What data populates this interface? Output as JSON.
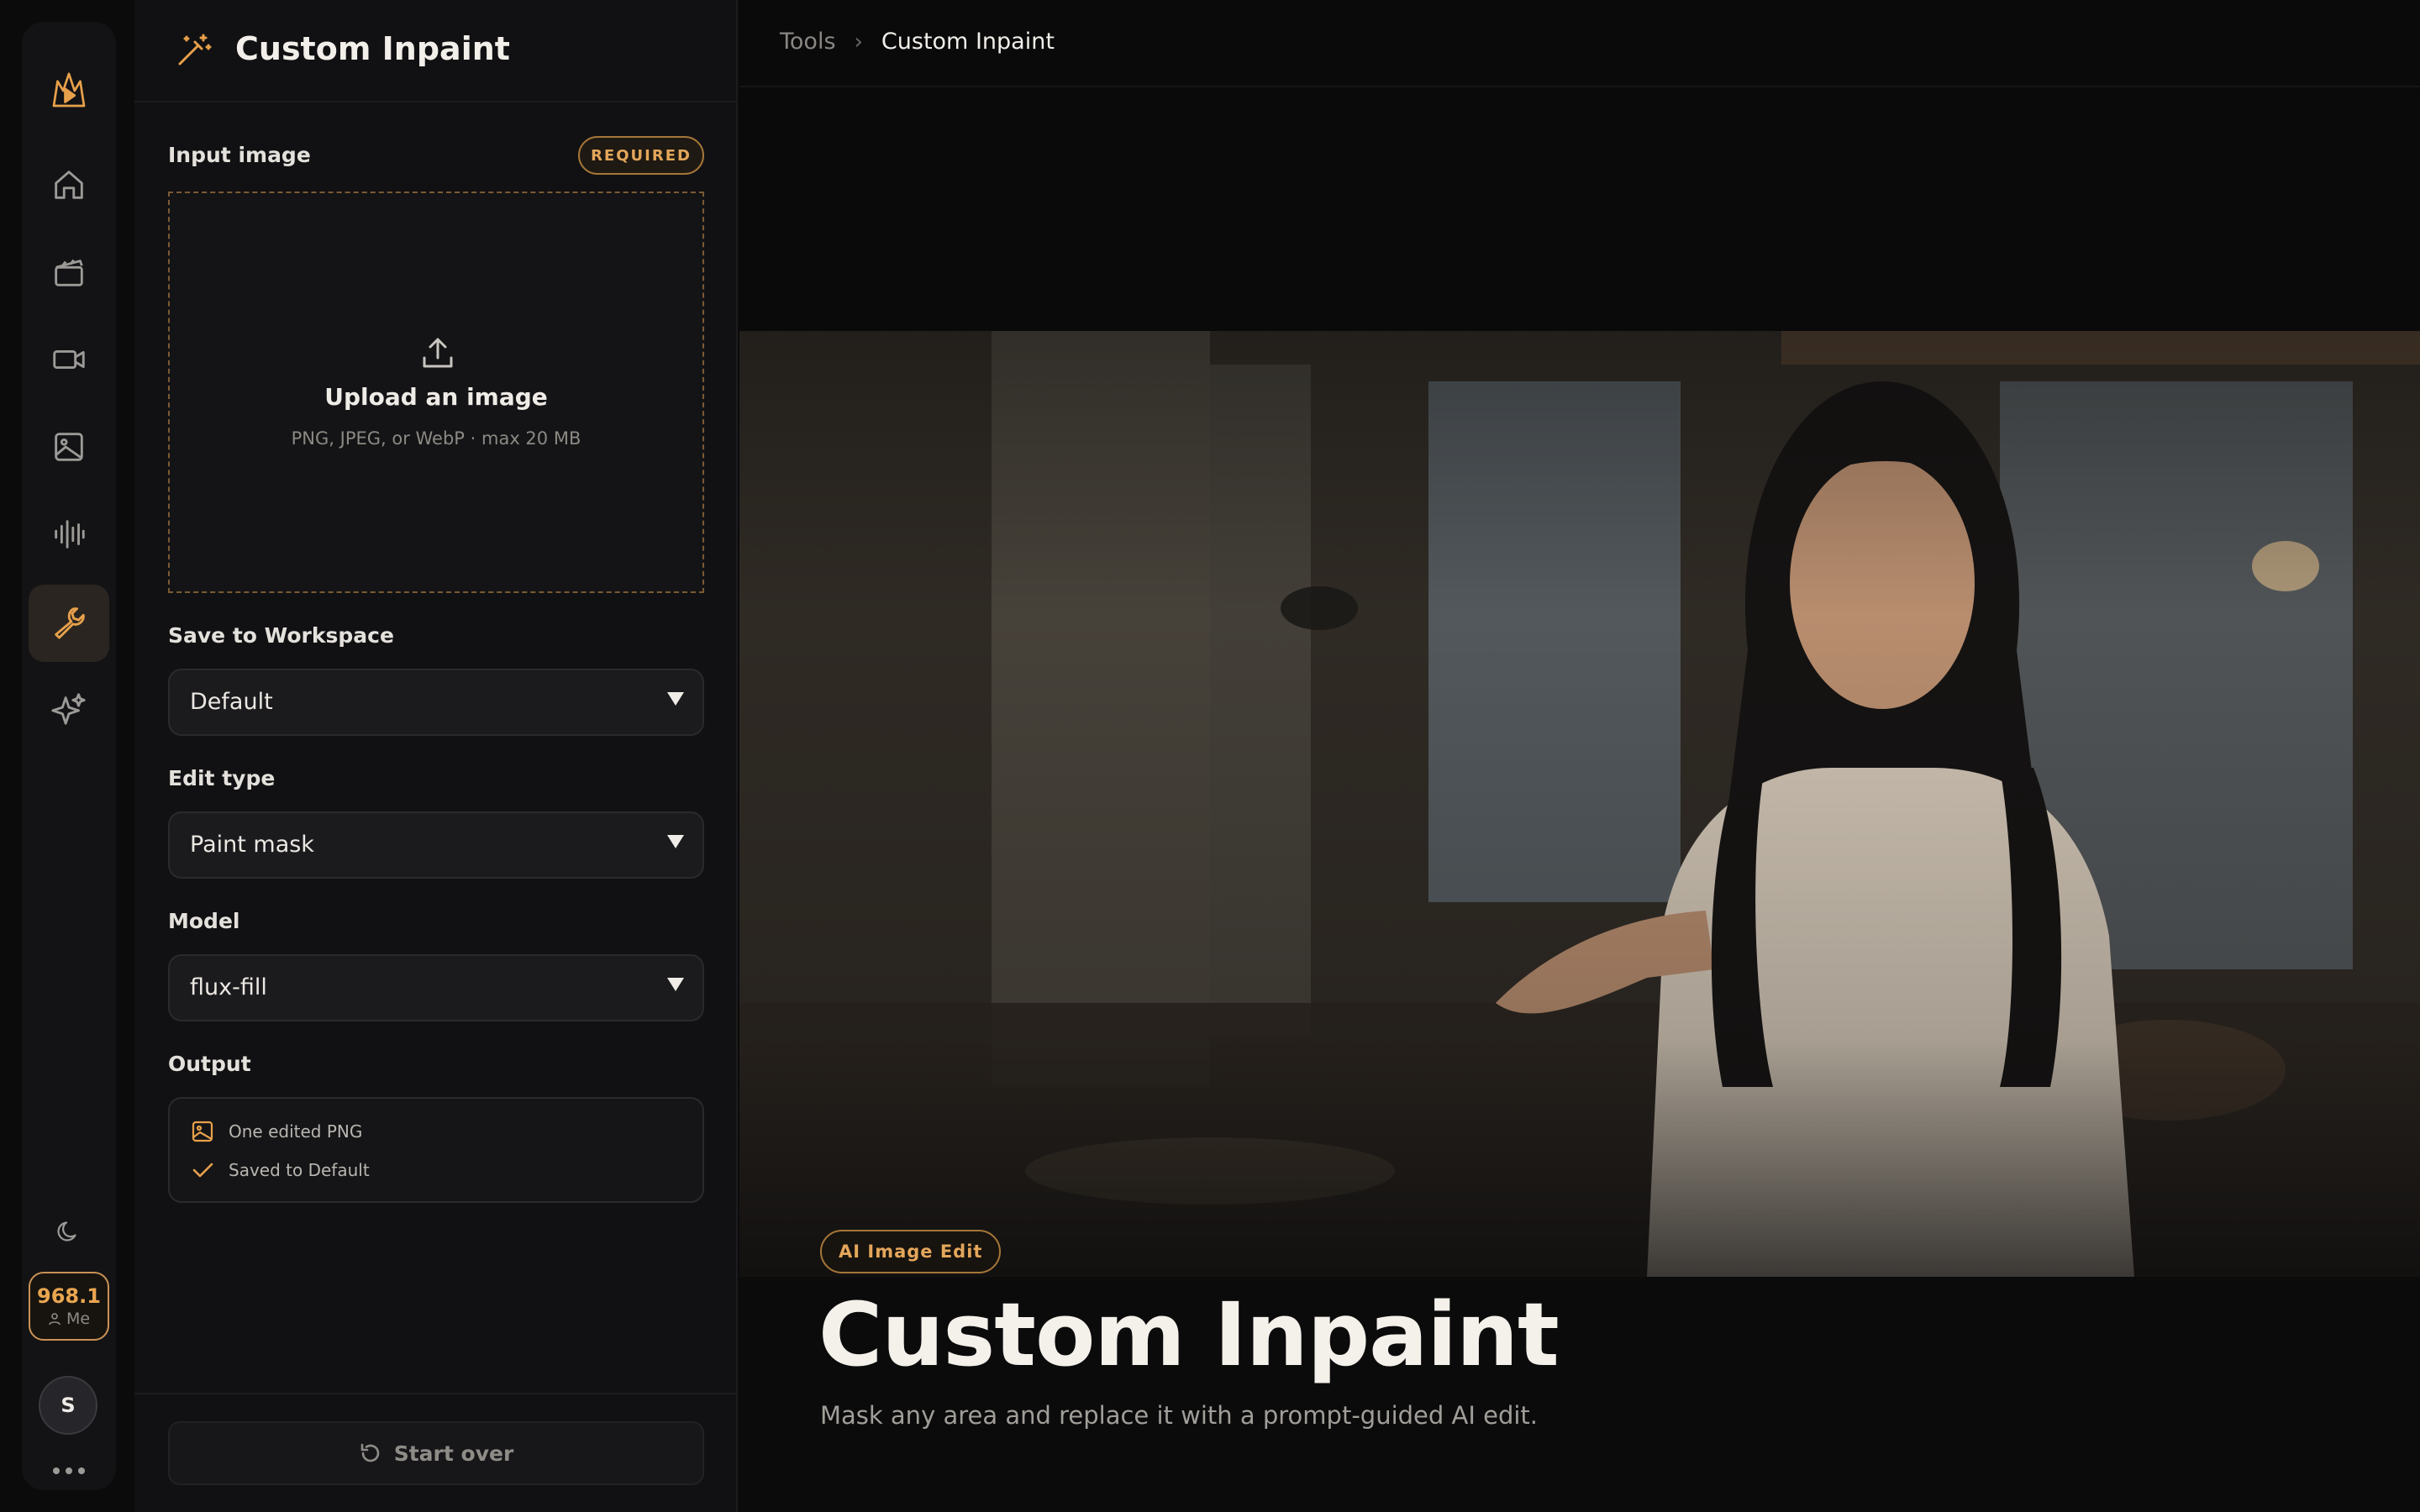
{
  "sidebar": {
    "items": [
      {
        "icon": "logo-icon"
      },
      {
        "icon": "home-icon"
      },
      {
        "icon": "clapperboard-icon"
      },
      {
        "icon": "video-camera-icon"
      },
      {
        "icon": "image-icon"
      },
      {
        "icon": "audio-waveform-icon"
      },
      {
        "icon": "wrench-icon",
        "active": true
      },
      {
        "icon": "sparkles-icon"
      }
    ],
    "theme_icon": "moon-icon",
    "credits": {
      "value": "968.1",
      "user": "Me"
    },
    "avatar_initial": "S"
  },
  "panel": {
    "title": "Custom Inpaint",
    "input_image": {
      "label": "Input image",
      "badge": "REQUIRED",
      "upload_title": "Upload an image",
      "upload_hint": "PNG, JPEG, or WebP · max 20 MB"
    },
    "workspace": {
      "label": "Save to Workspace",
      "value": "Default"
    },
    "edit_type": {
      "label": "Edit type",
      "value": "Paint mask"
    },
    "model": {
      "label": "Model",
      "value": "flux-fill"
    },
    "output": {
      "label": "Output",
      "items": [
        "One edited PNG",
        "Saved to Default"
      ]
    },
    "start_over_label": "Start over"
  },
  "main": {
    "breadcrumb": [
      "Tools",
      "Custom Inpaint"
    ],
    "tag": "AI Image Edit",
    "title": "Custom Inpaint",
    "subtitle": "Mask any area and replace it with a prompt-guided AI edit."
  },
  "colors": {
    "accent": "#e8a14b",
    "background": "#0b0b0c",
    "panel": "#111113"
  }
}
